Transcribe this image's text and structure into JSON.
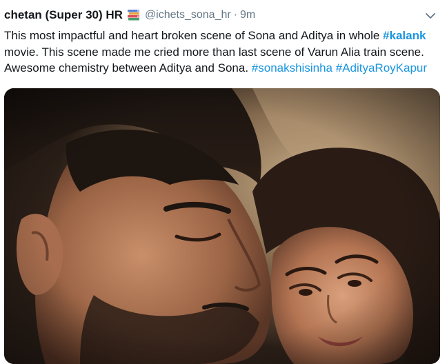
{
  "tweet": {
    "display_name": "chetan (Super 30) HR",
    "badge_icon": "books-emoji-icon",
    "handle": "@ichets_sona_hr",
    "separator": "·",
    "time": "9m",
    "menu_icon": "chevron-down-icon",
    "text_parts": [
      "This most impactful and heart broken scene of Sona and Aditya in whole ",
      "#kalank",
      " movie. This scene made me cried more than last scene of Varun Alia train scene. Awesome chemistry between Aditya and Sona. ",
      "#sonakshisinha",
      " ",
      "#AdityaRoyKapur"
    ],
    "media": {
      "description_icon": "photo-image"
    }
  }
}
